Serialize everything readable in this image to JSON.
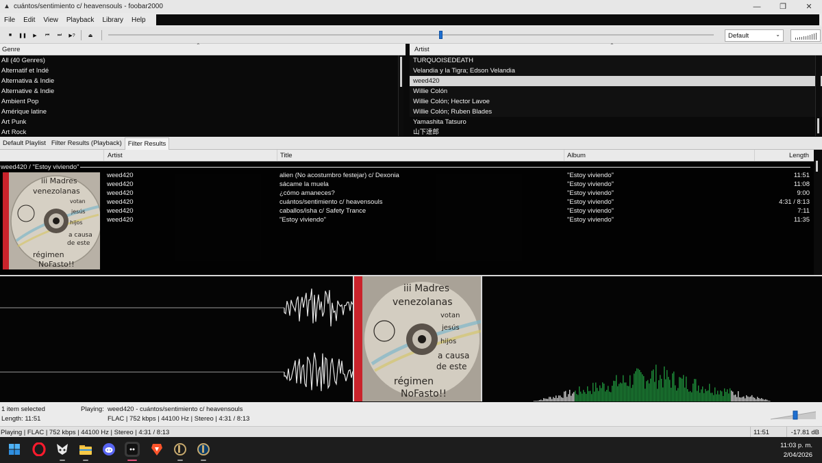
{
  "window": {
    "title": "cuántos/sentimiento c/ heavensouls - foobar2000",
    "app_icon": "foobar-icon",
    "controls": [
      "minimize-icon",
      "maximize-icon",
      "close-icon"
    ]
  },
  "menu": [
    "File",
    "Edit",
    "View",
    "Playback",
    "Library",
    "Help"
  ],
  "toolbar": {
    "buttons": [
      "stop-icon",
      "pause-icon",
      "play-icon",
      "previous-icon",
      "next-icon",
      "random-icon",
      "open-icon"
    ],
    "seek_progress": 0.55,
    "dsp_preset": "Default"
  },
  "genre_panel": {
    "header": "Genre",
    "items": [
      "All (40 Genres)",
      "Alternatif et Indé",
      "Alternativa & Indie",
      "Alternative & Indie",
      "Ambient Pop",
      "Amérique latine",
      "Art Punk",
      "Art Rock"
    ]
  },
  "artist_panel": {
    "header": "Artist",
    "items": [
      "TURQUOISEDEATH",
      "Velandia y la Tigra; Edson Velandia",
      "weed420",
      "Willie Colón",
      "Willie Colón; Hector Lavoe",
      "Willie Colón; Ruben Blades",
      "Yamashita Tatsuro",
      "山下達郎"
    ],
    "selected_index": 2
  },
  "tabs": [
    "Default Playlist",
    "Filter Results (Playback)",
    "Filter Results"
  ],
  "active_tab": 2,
  "playlist": {
    "columns": {
      "artist": "Artist",
      "title": "Title",
      "album": "Album",
      "length": "Length"
    },
    "group_header": "weed420 / \"Estoy viviendo\"",
    "rows": [
      {
        "artist": "weed420",
        "title": "alien (No acostumbro festejar) c/ Dexonia",
        "album": "\"Estoy viviendo\"",
        "length": "11:51"
      },
      {
        "artist": "weed420",
        "title": "sácame la muela",
        "album": "\"Estoy viviendo\"",
        "length": "11:08"
      },
      {
        "artist": "weed420",
        "title": "¿cómo amaneces?",
        "album": "\"Estoy viviendo\"",
        "length": "9:00"
      },
      {
        "artist": "weed420",
        "title": "cuántos/sentimiento c/ heavensouls",
        "album": "\"Estoy viviendo\"",
        "length": "4:31 / 8:13"
      },
      {
        "artist": "weed420",
        "title": "caballos/isha c/ Safety Trance",
        "album": "\"Estoy viviendo\"",
        "length": "7:11"
      },
      {
        "artist": "weed420",
        "title": "\"Estoy viviendo\"",
        "album": "\"Estoy viviendo\"",
        "length": "11:35"
      }
    ]
  },
  "album_art": {
    "lines": [
      "iii Madres",
      "venezolanas",
      "votan",
      "jesús",
      "hijos",
      "a causa",
      "de este",
      "régimen",
      "NoFasto!!"
    ]
  },
  "info_bar": {
    "selection": "1 item selected",
    "length": "Length: 11:51",
    "playing_label": "Playing:",
    "playing_track": "weed420 - cuántos/sentimiento c/ heavensouls",
    "format": "FLAC | 752 kbps | 44100 Hz | Stereo | 4:31 / 8:13",
    "volume_level": 0.55
  },
  "status_bar": {
    "text": "Playing | FLAC | 752 kbps | 44100 Hz | Stereo | 4:31 / 8:13",
    "selection_length": "11:51",
    "volume": "-17.81 dB"
  },
  "taskbar": {
    "apps": [
      "windows-start-icon",
      "opera-icon",
      "fox-app-icon",
      "file-explorer-icon",
      "discord-icon",
      "foobar-taskbar-icon",
      "brave-icon",
      "league-client-icon",
      "league-game-icon"
    ],
    "active_app": "foobar-taskbar-icon",
    "time": "11:03 p. m.",
    "date": "2/04/2026"
  }
}
